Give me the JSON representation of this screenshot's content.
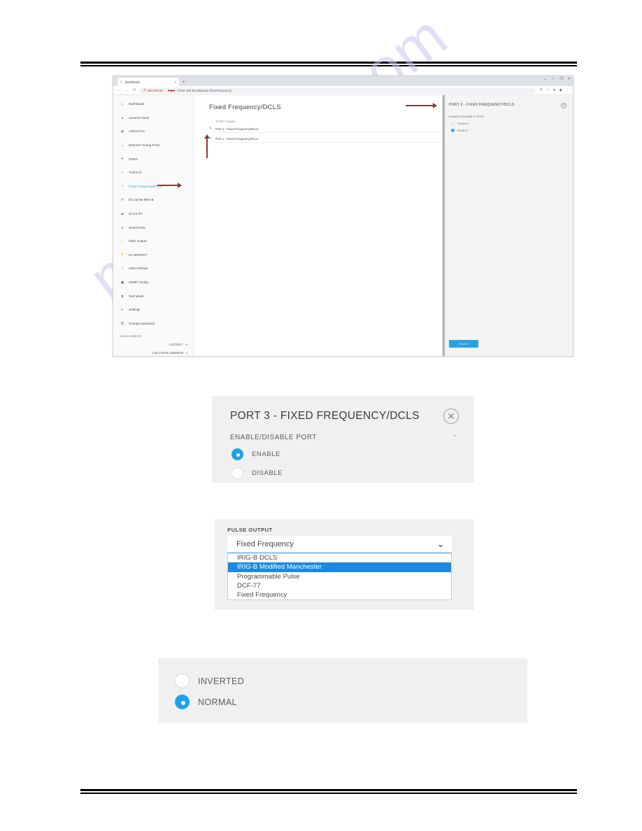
{
  "watermark": "manualslib.com",
  "browser": {
    "tab": {
      "title": "Dashboard",
      "favicon": "page-icon",
      "close": "×"
    },
    "new_tab": "+",
    "window_controls": [
      "⌄",
      "—",
      "❐",
      "✕"
    ],
    "nav": {
      "back": "←",
      "forward": "→",
      "reload": "⟳"
    },
    "omnibox": {
      "warning_icon": "⚠",
      "warning_text": "Not secure",
      "separator": "|",
      "url_protocol": "https",
      "url_rest": "://192.168.88.80/pulse-fixed-frequency"
    },
    "extensions": [
      "puzzle-icon",
      "star-icon",
      "extension-icon",
      "profile-icon",
      "menu-icon"
    ]
  },
  "sidebar": {
    "items": [
      {
        "label": "Dashboard",
        "icon": "home-icon",
        "glyph": "⌂",
        "active": false
      },
      {
        "label": "General Clock",
        "icon": "clock-icon",
        "glyph": "◕",
        "active": false
      },
      {
        "label": "Admin Port",
        "icon": "server-icon",
        "glyph": "▤",
        "active": false
      },
      {
        "label": "Ethernet Timing Ports",
        "icon": "network-icon",
        "glyph": "⛬",
        "active": false
      },
      {
        "label": "GNSS",
        "icon": "satellite-icon",
        "glyph": "✦",
        "active": false
      },
      {
        "label": "T1/E1/J1",
        "icon": "waveform-icon",
        "glyph": "⌁",
        "active": false
      },
      {
        "label": "Fixed Frequency/DCLS",
        "icon": "sine-wave-icon",
        "glyph": "∿",
        "active": true
      },
      {
        "label": "DCLS/AM IRIG-B",
        "icon": "square-wave-icon",
        "glyph": "⊓",
        "active": false
      },
      {
        "label": "DCLS I/O",
        "icon": "arrows-icon",
        "glyph": "⇄",
        "active": false
      },
      {
        "label": "Serial Ports",
        "icon": "lines-icon",
        "glyph": "≡",
        "active": false
      },
      {
        "label": "Fiber Output",
        "icon": "bulb-icon",
        "glyph": "◌",
        "active": false
      },
      {
        "label": "HV MOSFET",
        "icon": "bolt-icon",
        "glyph": "⚡",
        "active": false
      },
      {
        "label": "Alarm Relays",
        "icon": "bell-icon",
        "glyph": "♪",
        "active": false
      },
      {
        "label": "SNMP Config",
        "icon": "grid-icon",
        "glyph": "▩",
        "active": false
      },
      {
        "label": "Test Mode",
        "icon": "hourglass-icon",
        "glyph": "⧗",
        "active": false
      },
      {
        "label": "Settings",
        "icon": "tools-icon",
        "glyph": "✂",
        "active": false
      },
      {
        "label": "Change password",
        "icon": "lock-icon",
        "glyph": "⚿",
        "active": false
      }
    ],
    "version": "Version 3.0b5.01",
    "logout_label": "LOGOUT",
    "logout_icon": "exit-icon",
    "collapse_label": "COLLAPSE SIDEBAR",
    "collapse_icon": "chevrons-left-icon"
  },
  "main": {
    "title": "Fixed Frequency/DCLS",
    "table_header": "PORT NAME",
    "rows": [
      {
        "label": "Port 3 - Fixed Frequency/DCLS",
        "edit_icon": "pencil-icon"
      },
      {
        "label": "Port 4 - Fixed Frequency/DCLS",
        "edit_icon": "pencil-icon"
      }
    ]
  },
  "right_panel": {
    "title": "PORT 3 - FIXED FREQUENCY/DCLS",
    "close_icon": "close-circle-icon",
    "close_glyph": "✕",
    "section_label": "ENABLE/DISABLE PORT",
    "collapse_caret": "⌃",
    "options": [
      {
        "label": "ENABLE",
        "selected": true
      },
      {
        "label": "DISABLE",
        "selected": false
      }
    ],
    "save_label": "SAVE",
    "bottom_caret": "⌃"
  },
  "fig_enable_card": {
    "title": "PORT 3 - FIXED FREQUENCY/DCLS",
    "close_glyph": "✕",
    "section_label": "ENABLE/DISABLE PORT",
    "collapse_caret": "⌃",
    "options": [
      {
        "label": "ENABLE",
        "selected": true
      },
      {
        "label": "DISABLE",
        "selected": false
      }
    ]
  },
  "fig_pulse_output": {
    "label": "PULSE OUTPUT",
    "selected_value": "Fixed Frequency",
    "chevron": "⌄",
    "options": [
      {
        "label": "IRIG-B DCLS",
        "highlighted": false
      },
      {
        "label": "IRIG-B Modified Manchester",
        "highlighted": true
      },
      {
        "label": "Programmable Pulse",
        "highlighted": false
      },
      {
        "label": "DCF-77",
        "highlighted": false
      },
      {
        "label": "Fixed Frequency",
        "highlighted": false
      }
    ]
  },
  "fig_polarity": {
    "options": [
      {
        "label": "INVERTED",
        "selected": false
      },
      {
        "label": "NORMAL",
        "selected": true
      }
    ]
  },
  "colors": {
    "accent": "#29a3e0",
    "highlight": "#1b8ae0",
    "arrow": "#8b3a2a",
    "panel_bg": "#f0f0f0",
    "watermark": "#c9c6ef"
  }
}
